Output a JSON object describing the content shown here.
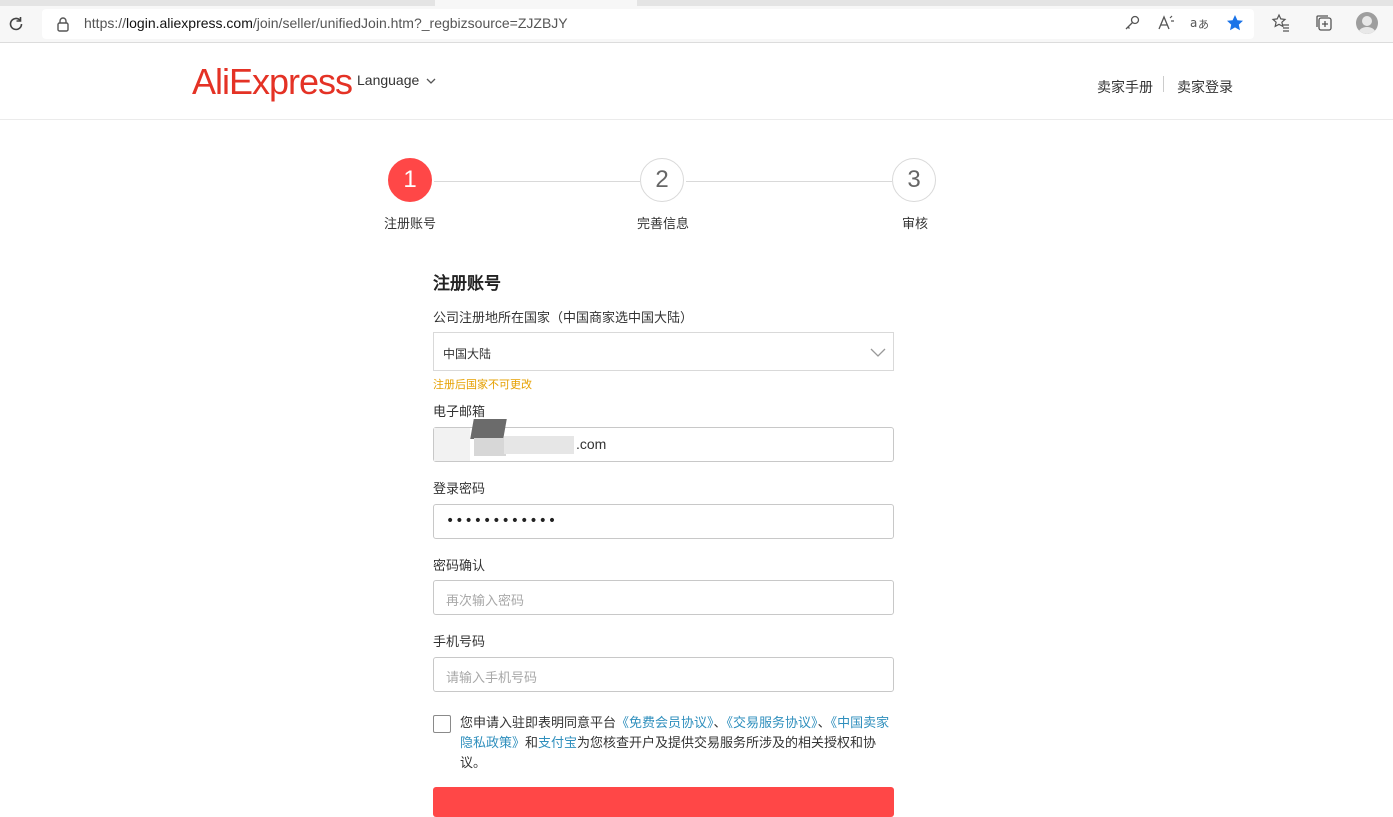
{
  "browser": {
    "url_prefix": "https://",
    "url_domain": "login.aliexpress.com",
    "url_rest": "/join/seller/unifiedJoin.htm?_regbizsource=ZJZBJY"
  },
  "header": {
    "logo": "AliExpress",
    "language": "Language",
    "links": [
      "卖家手册",
      "卖家登录"
    ]
  },
  "steps": [
    {
      "number": "1",
      "label": "注册账号",
      "active": true
    },
    {
      "number": "2",
      "label": "完善信息",
      "active": false
    },
    {
      "number": "3",
      "label": "审核",
      "active": false
    }
  ],
  "form": {
    "title": "注册账号",
    "country_label": "公司注册地所在国家（中国商家选中国大陆）",
    "country_value": "中国大陆",
    "country_hint": "注册后国家不可更改",
    "email_label": "电子邮箱",
    "email_visible_tail": ".com",
    "password_label": "登录密码",
    "password_value": "••••••••••••",
    "confirm_label": "密码确认",
    "confirm_placeholder": "再次输入密码",
    "phone_label": "手机号码",
    "phone_placeholder": "请输入手机号码"
  },
  "agreement": {
    "prefix": "您申请入驻即表明同意平台",
    "link1": "《免费会员协议》",
    "sep1": "、",
    "link2": "《交易服务协议》",
    "sep2": "、",
    "link3": "《中国卖家隐私政策》",
    "mid": "和",
    "link4": "支付宝",
    "suffix": "为您核查开户及提供交易服务所涉及的相关授权和协议。"
  },
  "colors": {
    "brand": "#e43225",
    "primary": "#ff4747",
    "hint": "#e6a000",
    "link": "#2f8fbd",
    "favorite_star": "#1a73e8"
  }
}
